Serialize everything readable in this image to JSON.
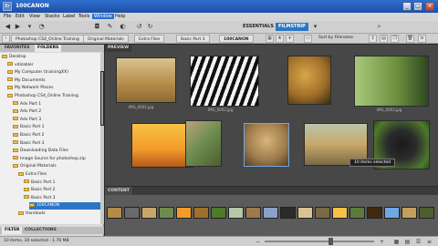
{
  "window": {
    "title": "100CANON",
    "menu": [
      "File",
      "Edit",
      "View",
      "Stacks",
      "Label",
      "Tools",
      "Window",
      "Help"
    ],
    "menu_highlight": "Window"
  },
  "toolbar": {
    "workspaces": [
      "ESSENTIALS",
      "FILMSTRIP"
    ],
    "active_workspace": "FILMSTRIP"
  },
  "pathbar": {
    "crumbs": [
      "Photoshop CS4_Online Training",
      "Original Materials",
      "Extra Files",
      "Basic Part 3",
      "100CANON"
    ],
    "sort_label": "Sort by Filename"
  },
  "left_panel": {
    "tabs": [
      "FAVORITES",
      "FOLDERS"
    ],
    "active_tab": "FOLDERS",
    "bottom_tabs": [
      "FILTER",
      "COLLECTIONS"
    ],
    "tree": [
      {
        "label": "Desktop",
        "level": 0
      },
      {
        "label": "vdizabler",
        "level": 1
      },
      {
        "label": "My Computer (trainingXX)",
        "level": 1
      },
      {
        "label": "My Documents",
        "level": 1
      },
      {
        "label": "My Network Places",
        "level": 1
      },
      {
        "label": "Photoshop CS4_Online Training",
        "level": 1
      },
      {
        "label": "Adv Part 1",
        "level": 2
      },
      {
        "label": "Adv Part 2",
        "level": 2
      },
      {
        "label": "Adv Part 3",
        "level": 2
      },
      {
        "label": "Basic Part 1",
        "level": 2
      },
      {
        "label": "Basic Part 2",
        "level": 2
      },
      {
        "label": "Basic Part 3",
        "level": 2
      },
      {
        "label": "Downloading Data Files",
        "level": 2
      },
      {
        "label": "Image Source for photoshop.zip",
        "level": 2
      },
      {
        "label": "Original Materials",
        "level": 2
      },
      {
        "label": "Extra Files",
        "level": 3
      },
      {
        "label": "Basic Part 1",
        "level": 4
      },
      {
        "label": "Basic Part 2",
        "level": 4
      },
      {
        "label": "Basic Part 3",
        "level": 4
      },
      {
        "label": "100CANON",
        "level": 5
      },
      {
        "label": "Handouts",
        "level": 3
      }
    ],
    "selected": "100CANON"
  },
  "content": {
    "preview_label": "PREVIEW",
    "content_label": "CONTENT",
    "tooltip": "10 items selected",
    "captions": [
      "IMG_0001.jpg",
      "IMG_0002.jpg",
      "IMG_0003.jpg"
    ]
  },
  "status": {
    "text": "10 items, 10 selected - 1.76 MB"
  }
}
